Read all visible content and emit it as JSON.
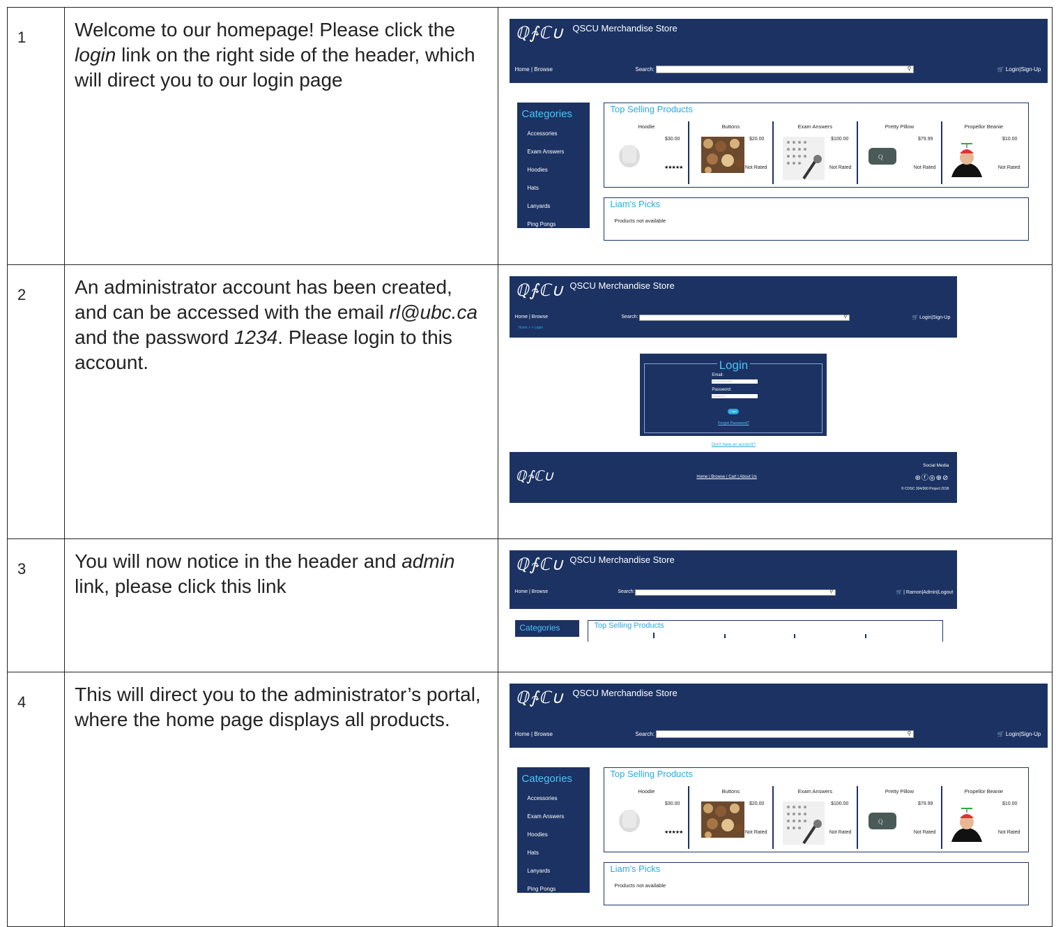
{
  "rows": [
    {
      "num": "1",
      "text_parts": [
        "Welcome to our homepage! Please click the ",
        "login",
        " link on the right side of the header, which will direct you to our login page"
      ]
    },
    {
      "num": "2",
      "text_parts": [
        "An administrator account has been created, and can be accessed with the email ",
        "rl@ubc.ca",
        " and the password ",
        "1234",
        ". Please login to this account."
      ]
    },
    {
      "num": "3",
      "text_parts": [
        "You will now notice in the header and ",
        "admin",
        " link, please click this link"
      ]
    },
    {
      "num": "4",
      "text": "This will direct you to the administrator’s portal, where the home page displays all products."
    }
  ],
  "site": {
    "logo": "ℚ∱ℂ∪",
    "title": "QSCU Merchandise Store",
    "nav": "Home | Browse",
    "search_label": "Search:",
    "search_icon": "magnifier-icon",
    "login": "🛒 Login|Sign-Up",
    "login_admin": "🛒 | Ramon|Admin|Logout",
    "categories_title": "Categories",
    "categories": [
      "Accessories",
      "Exam Answers",
      "Hoodies",
      "Hats",
      "Lanyards",
      "Ping Pongs"
    ],
    "top_selling_title": "Top Selling Products",
    "products": [
      {
        "name": "Hoodie",
        "price": "$30.00",
        "rating": "★★★★★"
      },
      {
        "name": "Buttons",
        "price": "$20.00",
        "rating": "Not Rated"
      },
      {
        "name": "Exam Answers",
        "price": "$100.00",
        "rating": "Not Rated"
      },
      {
        "name": "Pretty Pillow",
        "price": "$79.99",
        "rating": "Not Rated"
      },
      {
        "name": "Propellor Beanie",
        "price": "$10.00",
        "rating": "Not Rated"
      }
    ],
    "picks_title": "Liam's Picks",
    "picks_text": "Products not available",
    "breadcrumb": "Home > > Login",
    "login_title": "Login",
    "email_label": "Email:",
    "email_placeholder": "you@email.com",
    "password_label": "Password:",
    "password_placeholder": "Password",
    "login_button": "Login",
    "forgot": "Forgot Password?",
    "no_account": "Don't have an account?",
    "footer_links": "Home | Browse | Cart | About Us",
    "footer_social": "Social Media",
    "footer_icons": "⊛ⓕ◎⊕⊘",
    "footer_copy": "© COSC 304/360 Project 2018"
  },
  "colors": {
    "navy": "#1b3263",
    "accent": "#29a9e0"
  }
}
